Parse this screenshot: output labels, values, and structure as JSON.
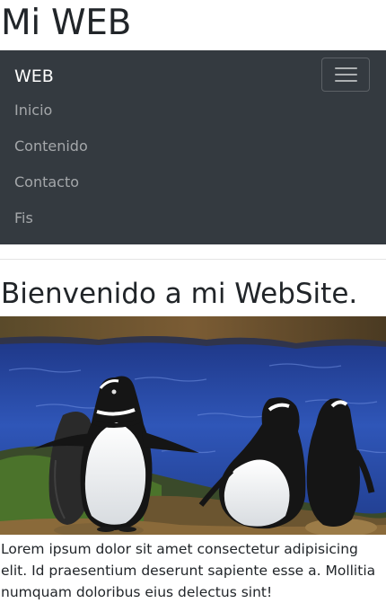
{
  "header": {
    "title": "Mi WEB"
  },
  "navbar": {
    "brand": "WEB",
    "toggler_icon": "hamburger-menu-icon",
    "items": [
      {
        "label": "Inicio"
      },
      {
        "label": "Contenido"
      },
      {
        "label": "Contacto"
      },
      {
        "label": "Fis"
      }
    ],
    "colors": {
      "background": "#343a40",
      "brand_text": "#ffffff",
      "link_text": "#a0a4a8"
    }
  },
  "main": {
    "heading": "Bienvenido a mi WebSite.",
    "image": {
      "subject": "penguins on a rocky shore by the sea"
    },
    "paragraph": "Lorem ipsum dolor sit amet consectetur adipisicing elit. Id praesentium deserunt sapiente esse a. Mollitia numquam doloribus eius delectus sint!"
  }
}
